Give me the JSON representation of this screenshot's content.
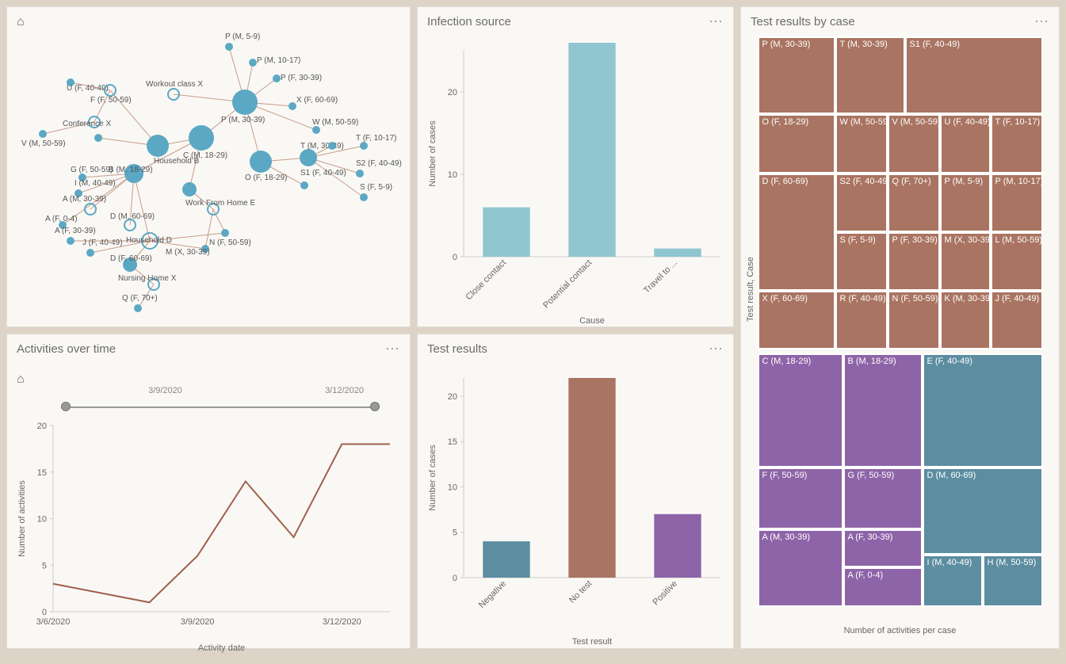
{
  "infection_source": {
    "title": "Infection source"
  },
  "test_results": {
    "title": "Test results"
  },
  "test_results_by_case": {
    "title": "Test results by case",
    "xlabel": "Number of activities per case",
    "ylabel": "Test result, Case"
  },
  "activities_over_time": {
    "title": "Activities over time",
    "slider_start": "3/9/2020",
    "slider_end": "3/12/2020"
  },
  "network": {
    "nodes": [
      "P (M, 5-9)",
      "P (M, 10-17)",
      "P (F, 30-39)",
      "Workout class X",
      "X (F, 60-69)",
      "P (M, 30-39)",
      "W (M, 50-59)",
      "U (F, 40-49)",
      "Conference X",
      "V (M, 50-59)",
      "F (F, 50-59)",
      "C (M, 18-29)",
      "Household B",
      "T (M, 30-39)",
      "T (F, 10-17)",
      "O (F, 18-29)",
      "S1 (F, 40-49)",
      "S2 (F, 40-49)",
      "S (F, 5-9)",
      "G (F, 50-59)",
      "B (M, 18-29)",
      "I (M, 40-49)",
      "A (M, 30-39)",
      "Work From Home E",
      "A (F, 0-4)",
      "D (M, 60-69)",
      "A (F, 30-39)",
      "Household D",
      "N (F, 50-59)",
      "J (F, 40-49)",
      "M (X, 30-39)",
      "D (F, 60-69)",
      "Nursing Home X",
      "Q (F, 70+)"
    ]
  },
  "chart_data": [
    {
      "id": "infection_source",
      "type": "bar",
      "title": "Infection source",
      "xlabel": "Cause",
      "ylabel": "Number of cases",
      "ylim": [
        0,
        25
      ],
      "categories": [
        "Close contact",
        "Potential contact",
        "Travel to ..."
      ],
      "values": [
        6,
        26,
        1
      ],
      "color": "#8fc6d0"
    },
    {
      "id": "test_results",
      "type": "bar",
      "title": "Test results",
      "xlabel": "Test result",
      "ylabel": "Number of cases",
      "ylim": [
        0,
        22
      ],
      "categories": [
        "Negative",
        "No test",
        "Positive"
      ],
      "values": [
        4,
        22,
        7
      ],
      "colors": [
        "#5c8da0",
        "#a97461",
        "#8e64a8"
      ]
    },
    {
      "id": "activities_over_time",
      "type": "line",
      "title": "Activities over time",
      "xlabel": "Activity date",
      "ylabel": "Number of activities",
      "ylim": [
        0,
        20
      ],
      "x": [
        "3/6/2020",
        "3/7/2020",
        "3/8/2020",
        "3/9/2020",
        "3/10/2020",
        "3/11/2020",
        "3/12/2020",
        "3/13/2020"
      ],
      "values": [
        3,
        2,
        1,
        6,
        14,
        8,
        18,
        18
      ],
      "color": "#a0604c"
    },
    {
      "id": "test_results_by_case",
      "type": "treemap",
      "title": "Test results by case",
      "series": [
        {
          "group": "No test",
          "color": "#a97461",
          "items": [
            {
              "name": "P (M, 30-39)",
              "value": 8
            },
            {
              "name": "T (M, 30-39)",
              "value": 5
            },
            {
              "name": "S1 (F, 40-49)",
              "value": 5
            },
            {
              "name": "O (F, 18-29)",
              "value": 4
            },
            {
              "name": "W (M, 50-59)",
              "value": 2
            },
            {
              "name": "V (M, 50-59)",
              "value": 2
            },
            {
              "name": "U (F, 40-49)",
              "value": 2
            },
            {
              "name": "T (F, 10-17)",
              "value": 2
            },
            {
              "name": "D (F, 60-69)",
              "value": 3
            },
            {
              "name": "S2 (F, 40-49)",
              "value": 2
            },
            {
              "name": "Q (F, 70+)",
              "value": 2
            },
            {
              "name": "P (M, 5-9)",
              "value": 2
            },
            {
              "name": "P (M, 10-17)",
              "value": 2
            },
            {
              "name": "S (F, 5-9)",
              "value": 2
            },
            {
              "name": "P (F, 30-39)",
              "value": 2
            },
            {
              "name": "M (X, 30-39)",
              "value": 2
            },
            {
              "name": "L (M, 50-59)",
              "value": 2
            },
            {
              "name": "X (F, 60-69)",
              "value": 2
            },
            {
              "name": "R (F, 40-49)",
              "value": 1
            },
            {
              "name": "N (F, 50-59)",
              "value": 1
            },
            {
              "name": "K (M, 30-39)",
              "value": 1
            },
            {
              "name": "J (F, 40-49)",
              "value": 1
            }
          ]
        },
        {
          "group": "Positive",
          "color": "#8e64a8",
          "items": [
            {
              "name": "C (M, 18-29)",
              "value": 5
            },
            {
              "name": "B (M, 18-29)",
              "value": 4
            },
            {
              "name": "F (F, 50-59)",
              "value": 3
            },
            {
              "name": "G (F, 50-59)",
              "value": 2
            },
            {
              "name": "A (M, 30-39)",
              "value": 3
            },
            {
              "name": "A (F, 30-39)",
              "value": 2
            },
            {
              "name": "A (F, 0-4)",
              "value": 2
            }
          ]
        },
        {
          "group": "Negative",
          "color": "#5c8da0",
          "items": [
            {
              "name": "E (F, 40-49)",
              "value": 5
            },
            {
              "name": "D (M, 60-69)",
              "value": 4
            },
            {
              "name": "I (M, 40-49)",
              "value": 2
            },
            {
              "name": "H (M, 50-59)",
              "value": 2
            }
          ]
        }
      ]
    }
  ]
}
